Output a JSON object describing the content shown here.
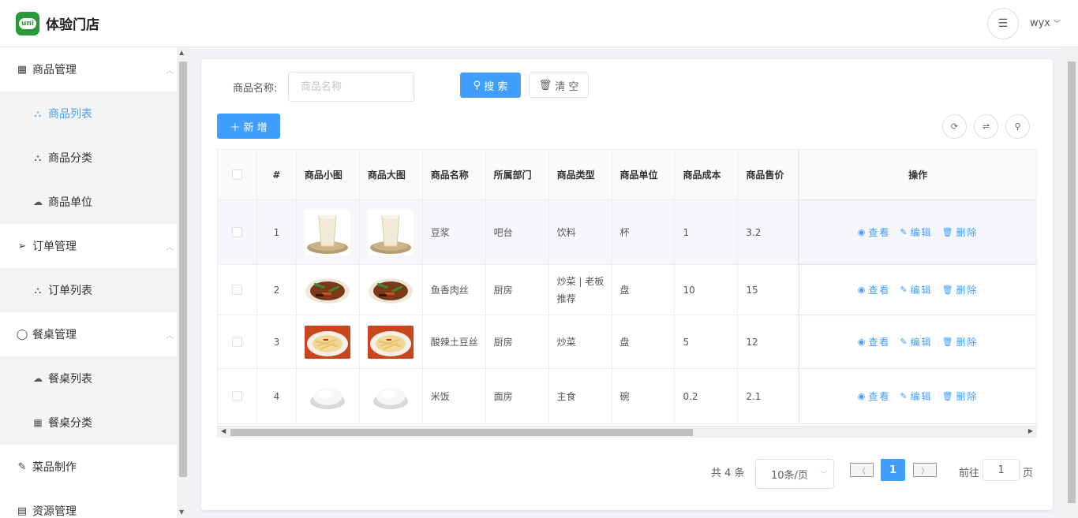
{
  "header": {
    "store_name": "体验门店",
    "logo_text": "uni",
    "user": "wyx"
  },
  "sidebar": {
    "groups": [
      {
        "label": "商品管理",
        "icon": "grid-icon",
        "children": [
          {
            "label": "商品列表",
            "icon": "sitemap-icon",
            "active": true
          },
          {
            "label": "商品分类",
            "icon": "sitemap-icon"
          },
          {
            "label": "商品单位",
            "icon": "cloud-icon"
          }
        ]
      },
      {
        "label": "订单管理",
        "icon": "send-icon",
        "children": [
          {
            "label": "订单列表",
            "icon": "sitemap-icon"
          }
        ]
      },
      {
        "label": "餐桌管理",
        "icon": "chat-icon",
        "children": [
          {
            "label": "餐桌列表",
            "icon": "cloud-icon"
          },
          {
            "label": "餐桌分类",
            "icon": "grid-icon"
          }
        ]
      },
      {
        "label": "菜品制作",
        "icon": "edit-icon",
        "children": []
      },
      {
        "label": "资源管理",
        "icon": "folder-icon",
        "children": []
      }
    ]
  },
  "search": {
    "label": "商品名称:",
    "placeholder": "商品名称",
    "search_btn": "搜 索",
    "clear_btn": "清 空"
  },
  "toolbar": {
    "add_btn": "新 增"
  },
  "table": {
    "headers": [
      "#",
      "商品小图",
      "商品大图",
      "商品名称",
      "所属部门",
      "商品类型",
      "商品单位",
      "商品成本",
      "商品售价",
      "操作"
    ],
    "rows": [
      {
        "idx": "1",
        "img": "soymilk",
        "name": "豆浆",
        "dept": "吧台",
        "type": "饮料",
        "unit": "杯",
        "cost": "1",
        "price": "3.2"
      },
      {
        "idx": "2",
        "img": "pork",
        "name": "鱼香肉丝",
        "dept": "厨房",
        "type": "炒菜 | 老板推荐",
        "unit": "盘",
        "cost": "10",
        "price": "15"
      },
      {
        "idx": "3",
        "img": "potato",
        "name": "酸辣土豆丝",
        "dept": "厨房",
        "type": "炒菜",
        "unit": "盘",
        "cost": "5",
        "price": "12"
      },
      {
        "idx": "4",
        "img": "rice",
        "name": "米饭",
        "dept": "面房",
        "type": "主食",
        "unit": "碗",
        "cost": "0.2",
        "price": "2.1"
      }
    ],
    "ops": {
      "view": "查看",
      "edit": "编辑",
      "delete": "删除"
    }
  },
  "pagination": {
    "total": "共 4 条",
    "page_size": "10条/页",
    "current": "1",
    "goto": "前往",
    "goto_value": "1",
    "suffix": "页"
  }
}
